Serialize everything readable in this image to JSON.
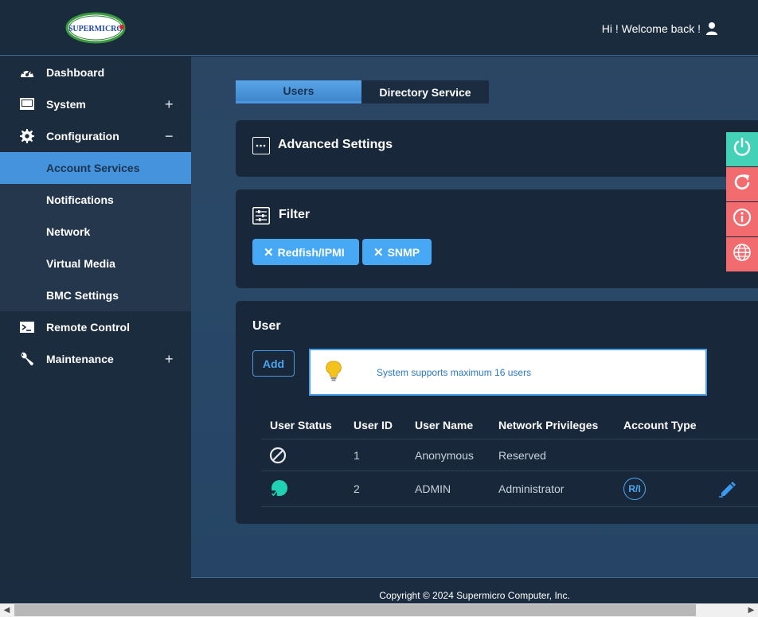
{
  "header": {
    "logo_text": "SUPERMICRO",
    "welcome": "Hi ! Welcome back !",
    "user_icon": "user-icon"
  },
  "sidebar": {
    "items": [
      {
        "label": "Dashboard",
        "icon": "gauge-icon",
        "toggle": ""
      },
      {
        "label": "System",
        "icon": "monitor-icon",
        "toggle": "+"
      },
      {
        "label": "Configuration",
        "icon": "gear-icon",
        "toggle": "−"
      },
      {
        "label": "Account Services",
        "icon": "",
        "toggle": ""
      },
      {
        "label": "Notifications",
        "icon": "",
        "toggle": ""
      },
      {
        "label": "Network",
        "icon": "",
        "toggle": ""
      },
      {
        "label": "Virtual Media",
        "icon": "",
        "toggle": ""
      },
      {
        "label": "BMC Settings",
        "icon": "",
        "toggle": ""
      },
      {
        "label": "Remote Control",
        "icon": "terminal-icon",
        "toggle": ""
      },
      {
        "label": "Maintenance",
        "icon": "wrench-icon",
        "toggle": "+"
      }
    ],
    "active": "Account Services"
  },
  "tabs": [
    {
      "label": "Users",
      "active": true
    },
    {
      "label": "Directory Service",
      "active": false
    }
  ],
  "advanced": {
    "title": "Advanced Settings",
    "icon": "ellipsis-icon"
  },
  "filter": {
    "title": "Filter",
    "icon": "sliders-icon",
    "chips": [
      "Redfish/IPMI",
      "SNMP"
    ],
    "chip_remove_glyph": "✕"
  },
  "user_section": {
    "title": "User",
    "add_label": "Add",
    "notice": "System supports maximum 16 users",
    "columns": [
      "User Status",
      "User ID",
      "User Name",
      "Network Privileges",
      "Account Type"
    ],
    "rows": [
      {
        "status_icon": "disabled-icon",
        "id": "1",
        "name": "Anonymous",
        "privilege": "Reserved",
        "account_type": ""
      },
      {
        "status_icon": "enabled-icon",
        "id": "2",
        "name": "ADMIN",
        "privilege": "Administrator",
        "account_type": "R/I",
        "edit_icon": "edit-icon"
      }
    ]
  },
  "floating_buttons": [
    "power-icon",
    "reset-icon",
    "info-icon",
    "globe-icon"
  ],
  "footer": {
    "copyright": "Copyright © 2024 Supermicro Computer, Inc."
  },
  "colors": {
    "accent": "#4593dc",
    "chip": "#47a9f5",
    "power": "#43d1b8",
    "alert": "#f16b6f"
  }
}
